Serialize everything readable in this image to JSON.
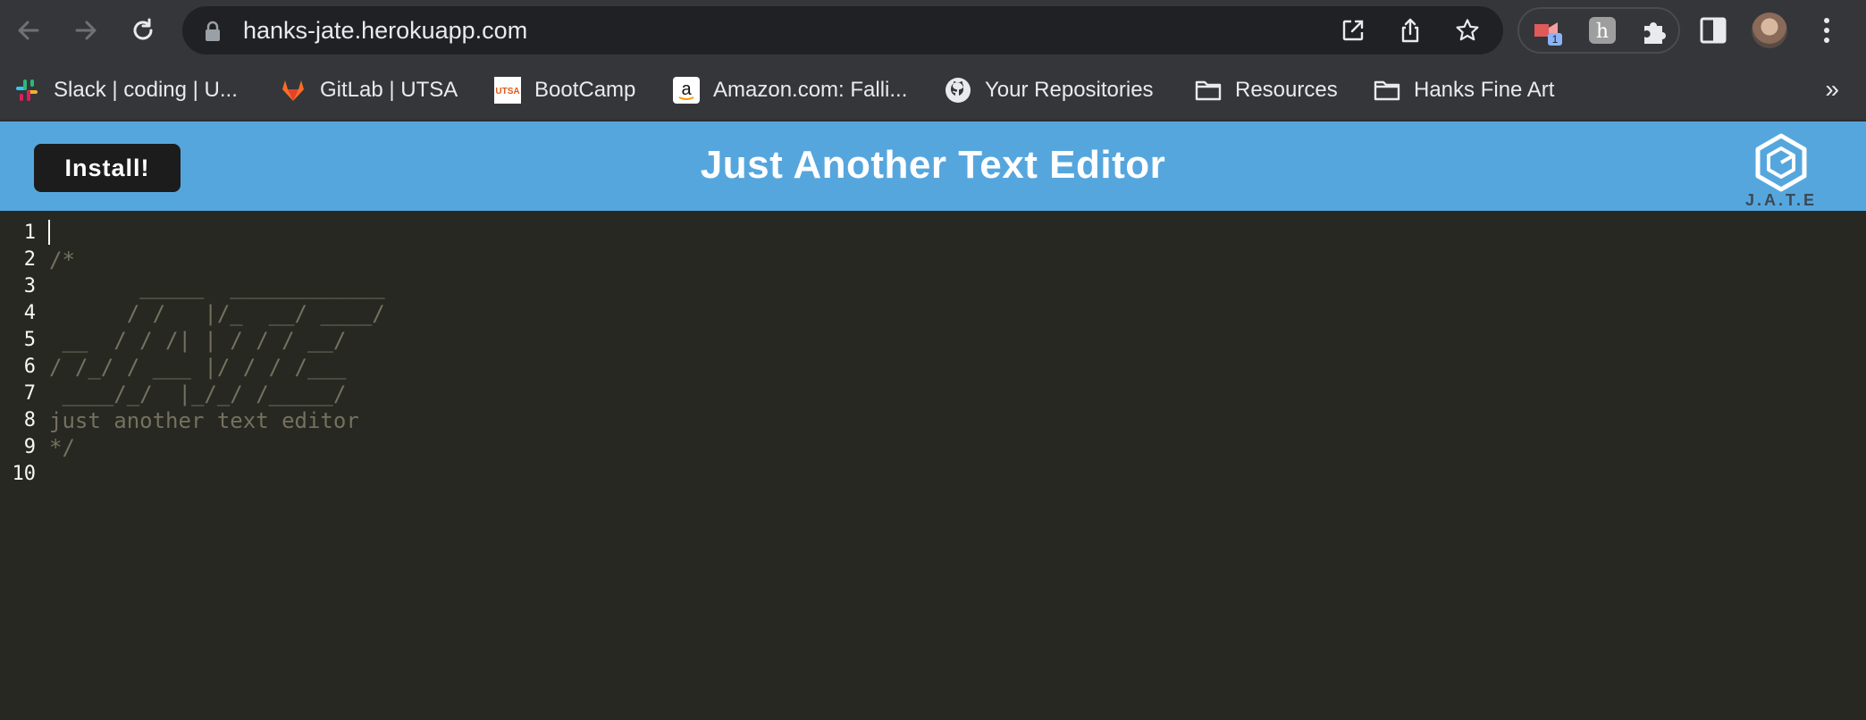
{
  "browser": {
    "url": "hanks-jate.herokuapp.com",
    "extension_badge": "1",
    "bookmarks": [
      {
        "label": "Slack | coding | U...",
        "icon": "slack-icon"
      },
      {
        "label": "GitLab | UTSA",
        "icon": "gitlab-icon"
      },
      {
        "label": "BootCamp",
        "icon": "utsa-icon"
      },
      {
        "label": "Amazon.com: Falli...",
        "icon": "amazon-icon"
      },
      {
        "label": "Your Repositories",
        "icon": "github-icon"
      },
      {
        "label": "Resources",
        "icon": "folder-icon"
      },
      {
        "label": "Hanks Fine Art",
        "icon": "folder-icon"
      }
    ],
    "bookmarks_more": "»"
  },
  "app": {
    "install_label": "Install!",
    "title": "Just Another Text Editor",
    "logo_text": "J.A.T.E",
    "header_color": "#56a6de"
  },
  "editor": {
    "lines": [
      {
        "num": "1",
        "text": ""
      },
      {
        "num": "2",
        "text": "/*"
      },
      {
        "num": "3",
        "text": "       _____  ____________"
      },
      {
        "num": "4",
        "text": "      / /   |/_  __/ ____/"
      },
      {
        "num": "5",
        "text": " __  / / /| | / / / __/"
      },
      {
        "num": "6",
        "text": "/ /_/ / ___ |/ / / /___"
      },
      {
        "num": "7",
        "text": " ____/_/  |_/_/ /_____/"
      },
      {
        "num": "8",
        "text": "just another text editor"
      },
      {
        "num": "9",
        "text": "*/"
      },
      {
        "num": "10",
        "text": ""
      }
    ]
  }
}
